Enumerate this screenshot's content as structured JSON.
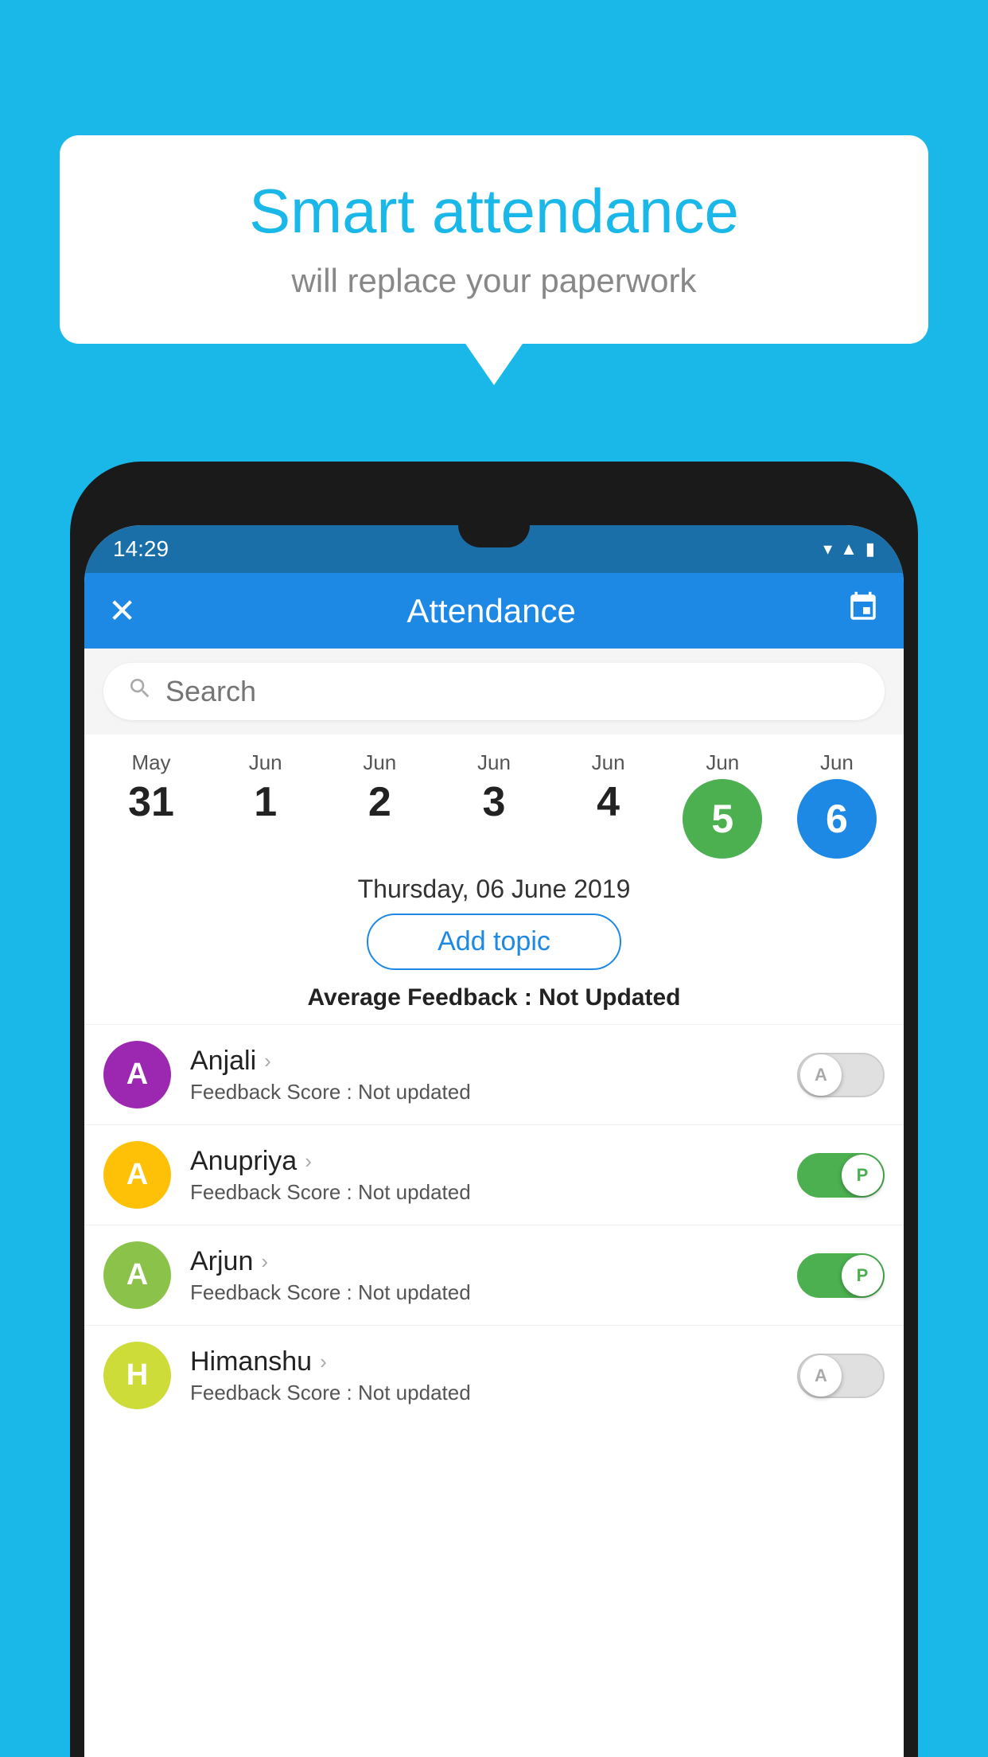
{
  "background": {
    "color": "#1ab8e8"
  },
  "bubble": {
    "title": "Smart attendance",
    "subtitle": "will replace your paperwork"
  },
  "statusBar": {
    "time": "14:29",
    "wifi_icon": "▾",
    "signal_icon": "▲",
    "battery_icon": "▮"
  },
  "appBar": {
    "title": "Attendance",
    "close_icon": "✕",
    "calendar_icon": "📅"
  },
  "search": {
    "placeholder": "Search"
  },
  "calendar": {
    "days": [
      {
        "month": "May",
        "date": "31",
        "type": "normal"
      },
      {
        "month": "Jun",
        "date": "1",
        "type": "normal"
      },
      {
        "month": "Jun",
        "date": "2",
        "type": "normal"
      },
      {
        "month": "Jun",
        "date": "3",
        "type": "normal"
      },
      {
        "month": "Jun",
        "date": "4",
        "type": "normal"
      },
      {
        "month": "Jun",
        "date": "5",
        "type": "green"
      },
      {
        "month": "Jun",
        "date": "6",
        "type": "blue"
      }
    ],
    "selected_date": "Thursday, 06 June 2019"
  },
  "addTopic": {
    "label": "Add topic"
  },
  "averageFeedback": {
    "label": "Average Feedback : ",
    "value": "Not Updated"
  },
  "students": [
    {
      "name": "Anjali",
      "initial": "A",
      "avatar_color": "purple",
      "feedback_label": "Feedback Score : ",
      "feedback_value": "Not updated",
      "toggle": "off",
      "toggle_label": "A"
    },
    {
      "name": "Anupriya",
      "initial": "A",
      "avatar_color": "yellow",
      "feedback_label": "Feedback Score : ",
      "feedback_value": "Not updated",
      "toggle": "on",
      "toggle_label": "P"
    },
    {
      "name": "Arjun",
      "initial": "A",
      "avatar_color": "green",
      "feedback_label": "Feedback Score : ",
      "feedback_value": "Not updated",
      "toggle": "on",
      "toggle_label": "P"
    },
    {
      "name": "Himanshu",
      "initial": "H",
      "avatar_color": "lime",
      "feedback_label": "Feedback Score : ",
      "feedback_value": "Not updated",
      "toggle": "off",
      "toggle_label": "A"
    }
  ]
}
